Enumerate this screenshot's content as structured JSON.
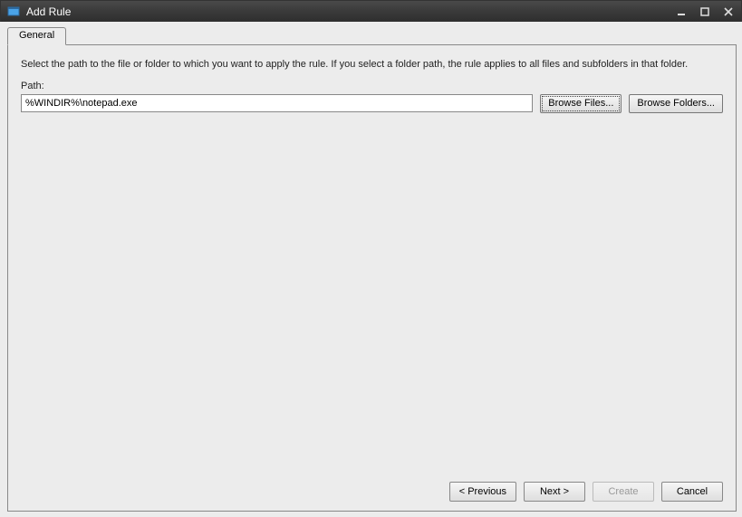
{
  "window": {
    "title": "Add Rule"
  },
  "tabs": {
    "general": "General"
  },
  "content": {
    "description": "Select the path to the file or folder to which you want to apply the rule. If you select a folder path, the rule applies to all files and subfolders in that folder.",
    "path_label": "Path:",
    "path_value": "%WINDIR%\\notepad.exe",
    "browse_files": "Browse Files...",
    "browse_folders": "Browse Folders..."
  },
  "footer": {
    "previous": "< Previous",
    "next": "Next >",
    "create": "Create",
    "cancel": "Cancel"
  }
}
